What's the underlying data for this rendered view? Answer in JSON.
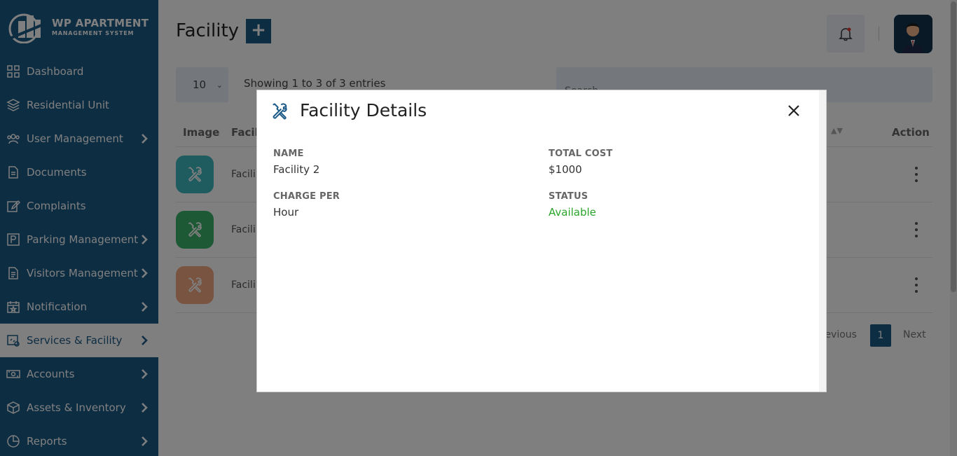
{
  "brand": {
    "title": "WP APARTMENT",
    "subtitle": "MANAGEMENT SYSTEM"
  },
  "sidebar": {
    "items": [
      {
        "label": "Dashboard",
        "icon": "grid-icon",
        "chevron": false
      },
      {
        "label": "Residential Unit",
        "icon": "layers-icon",
        "chevron": false
      },
      {
        "label": "User Management",
        "icon": "users-icon",
        "chevron": true
      },
      {
        "label": "Documents",
        "icon": "document-icon",
        "chevron": false
      },
      {
        "label": "Complaints",
        "icon": "edit-icon",
        "chevron": false
      },
      {
        "label": "Parking Management",
        "icon": "parking-icon",
        "chevron": true
      },
      {
        "label": "Visitors Management",
        "icon": "clipboard-icon",
        "chevron": true
      },
      {
        "label": "Notification",
        "icon": "calendar-star-icon",
        "chevron": true
      },
      {
        "label": "Services & Facility",
        "icon": "services-icon",
        "chevron": true,
        "active": true
      },
      {
        "label": "Accounts",
        "icon": "money-icon",
        "chevron": true
      },
      {
        "label": "Assets & Inventory",
        "icon": "box-icon",
        "chevron": true
      },
      {
        "label": "Reports",
        "icon": "pie-chart-icon",
        "chevron": true
      }
    ]
  },
  "header": {
    "title": "Facility",
    "add_label": "+"
  },
  "table": {
    "length_value": "10",
    "showing_text": "Showing 1 to 3 of 3 entries",
    "search_placeholder": "Search...",
    "columns": {
      "image": "Image",
      "name": "Facil",
      "action": "Action"
    },
    "rows": [
      {
        "name": "Facili",
        "color": "#3fb8bf"
      },
      {
        "name": "Facili",
        "color": "#3ab36a"
      },
      {
        "name": "Facili",
        "color": "#f2a880"
      }
    ],
    "pager": {
      "prev": "revious",
      "page": "1",
      "next": "Next"
    }
  },
  "modal": {
    "title": "Facility Details",
    "fields": {
      "name_label": "NAME",
      "name_value": "Facility 2",
      "total_cost_label": "TOTAL COST",
      "total_cost_value": "$1000",
      "charge_per_label": "CHARGE PER",
      "charge_per_value": "Hour",
      "status_label": "STATUS",
      "status_value": "Available"
    }
  },
  "colors": {
    "primary": "#1b5a86",
    "status_available": "#2aa52a"
  }
}
